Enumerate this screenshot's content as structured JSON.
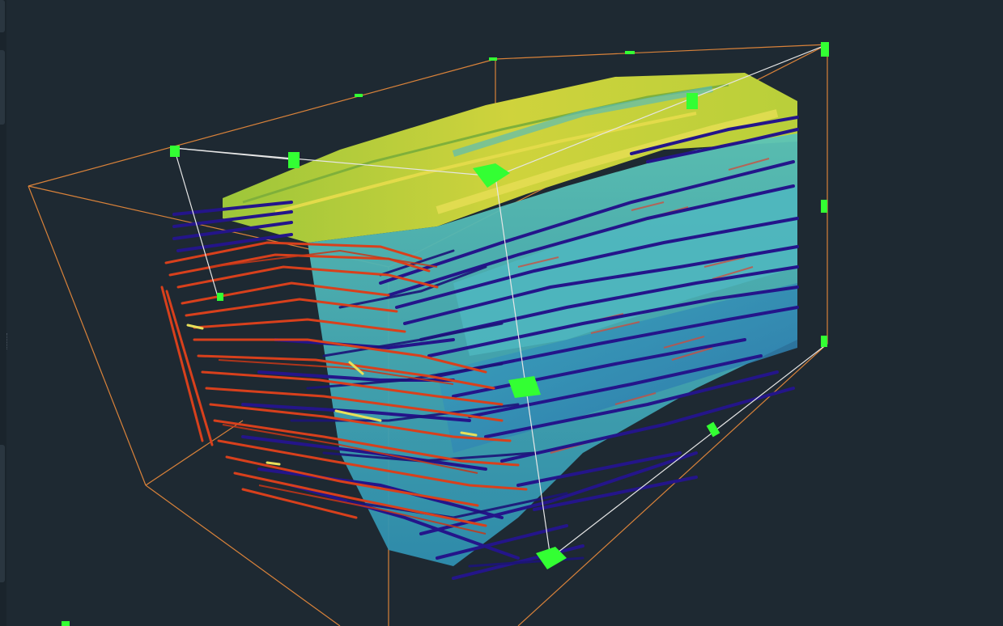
{
  "window": {
    "title": ""
  },
  "viewer": {
    "background_color": "#1e2932",
    "bounding_box_color": "#d9823a",
    "crop_box_color": "#e6e6e6",
    "handle_color": "#33ff33",
    "volume_colors": {
      "top_surface": "#c9d23a",
      "mid_surface": "#3fb7b0",
      "lower_surface": "#2e8fb0",
      "fiber_dark": "#2a1a8a",
      "fiber_red": "#d8401c",
      "fiber_yellow": "#e8e05a"
    }
  },
  "left_panel": {
    "tabs": [
      "tab-1",
      "tab-2",
      "tab-3"
    ]
  }
}
